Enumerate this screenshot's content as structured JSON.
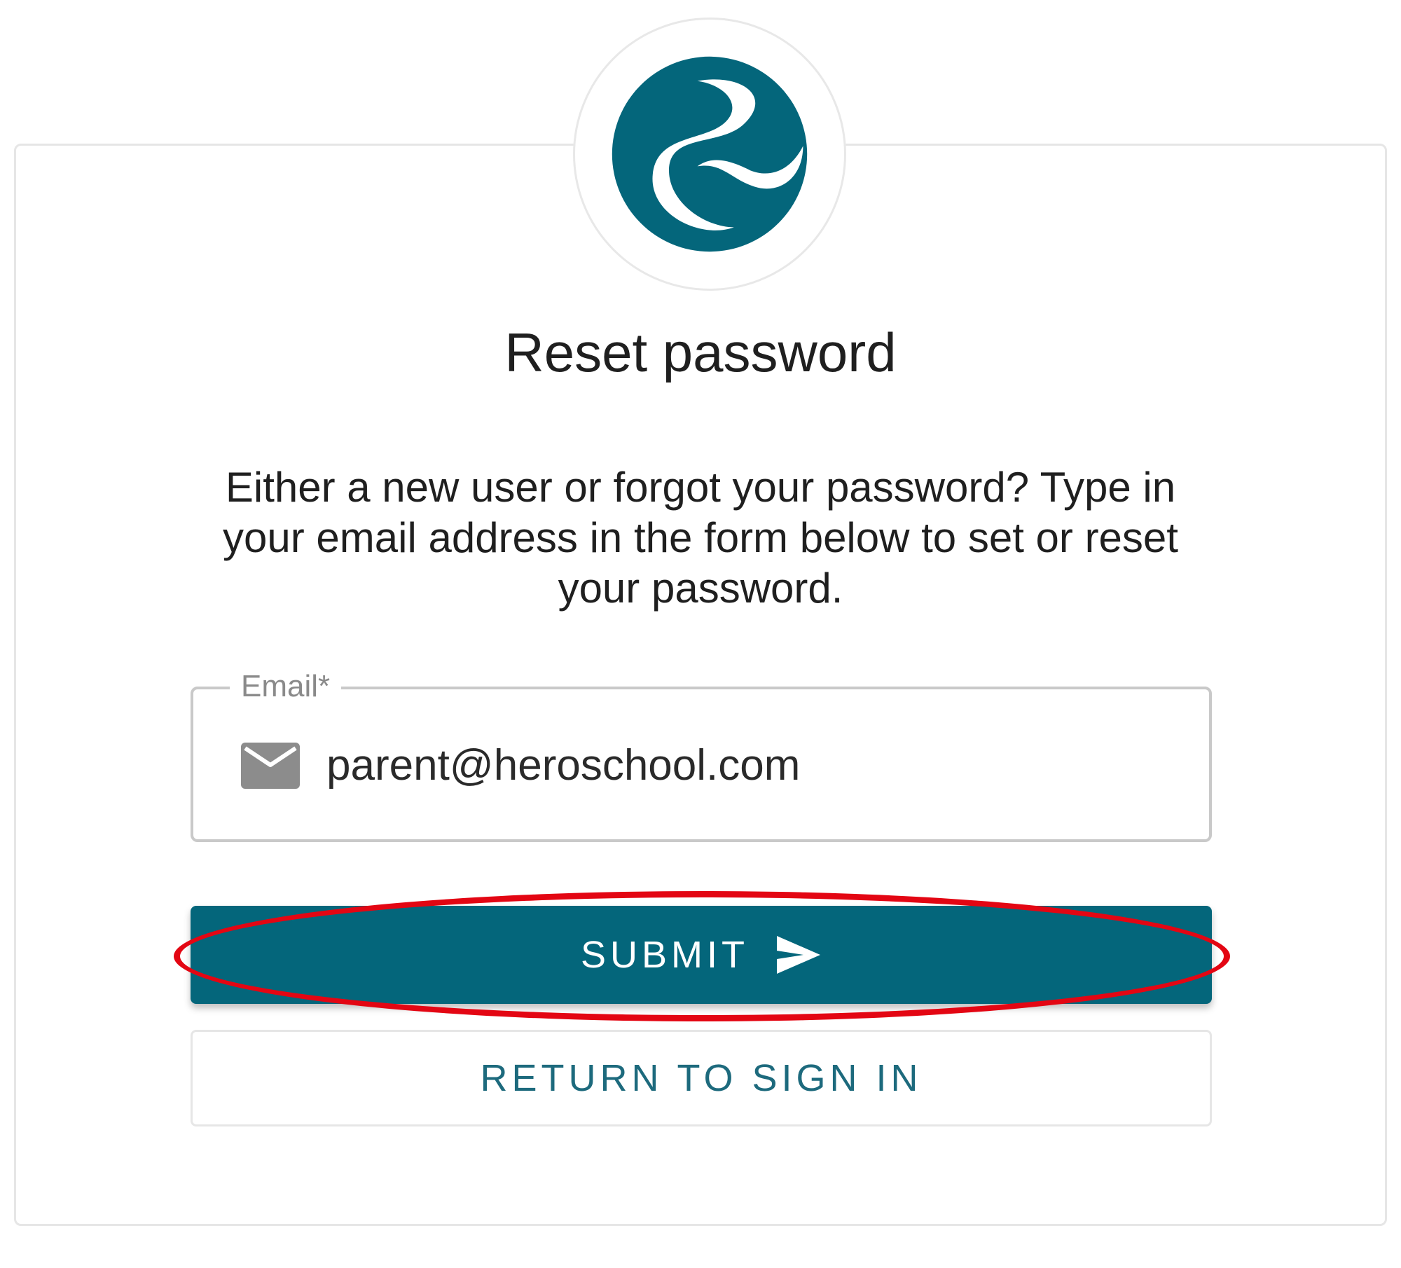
{
  "brand": {
    "logo_icon": "swirl-logo-icon",
    "accent_color": "#04667b",
    "highlight_color": "#e30613"
  },
  "page": {
    "title": "Reset password",
    "description": "Either a new user or forgot your password? Type in your email address in the form below to set or reset your password."
  },
  "email_field": {
    "label": "Email*",
    "icon": "mail-icon",
    "value": "parent@heroschool.com"
  },
  "actions": {
    "submit_label": "SUBMIT",
    "submit_icon": "send-icon",
    "return_label": "RETURN TO SIGN IN"
  }
}
